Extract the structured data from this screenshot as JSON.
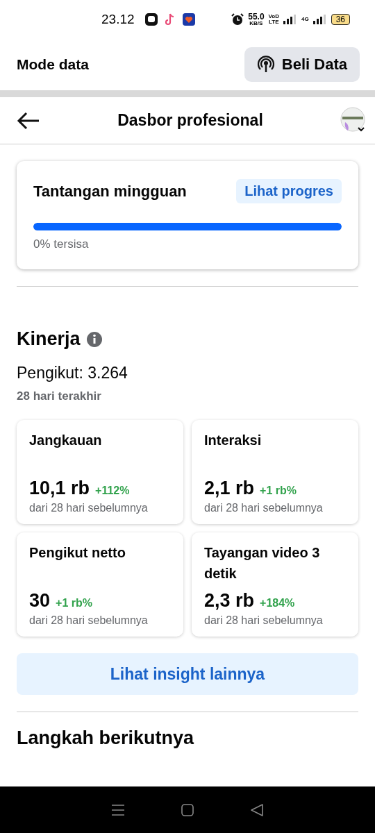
{
  "status_bar": {
    "time": "23.12",
    "speed": "55.0",
    "speed_unit": "KB/S",
    "network_top": "VoD",
    "network_bottom": "LTE",
    "network_type": "4G",
    "battery": "36"
  },
  "data_bar": {
    "title": "Mode data",
    "button": "Beli Data"
  },
  "header": {
    "title": "Dasbor profesional"
  },
  "challenge": {
    "title": "Tantangan mingguan",
    "link": "Lihat progres",
    "level": 1,
    "caption": "0% tersisa"
  },
  "performance": {
    "title": "Kinerja",
    "followers": "Pengikut: 3.264",
    "period": "28 hari terakhir",
    "cards": [
      {
        "label": "Jangkauan",
        "value": "10,1 rb",
        "change": "+112%",
        "note": "dari 28 hari sebelumnya"
      },
      {
        "label": "Interaksi",
        "value": "2,1 rb",
        "change": "+1 rb%",
        "note": "dari 28 hari sebelumnya"
      },
      {
        "label": "Pengikut netto",
        "value": "30",
        "change": "+1 rb%",
        "note": "dari 28 hari sebelumnya"
      },
      {
        "label": "Tayangan video 3 detik",
        "value": "2,3 rb",
        "change": "+184%",
        "note": "dari 28 hari sebelumnya"
      }
    ],
    "button": "Lihat insight lainnya"
  },
  "next_steps": {
    "title": "Langkah berikutnya"
  }
}
